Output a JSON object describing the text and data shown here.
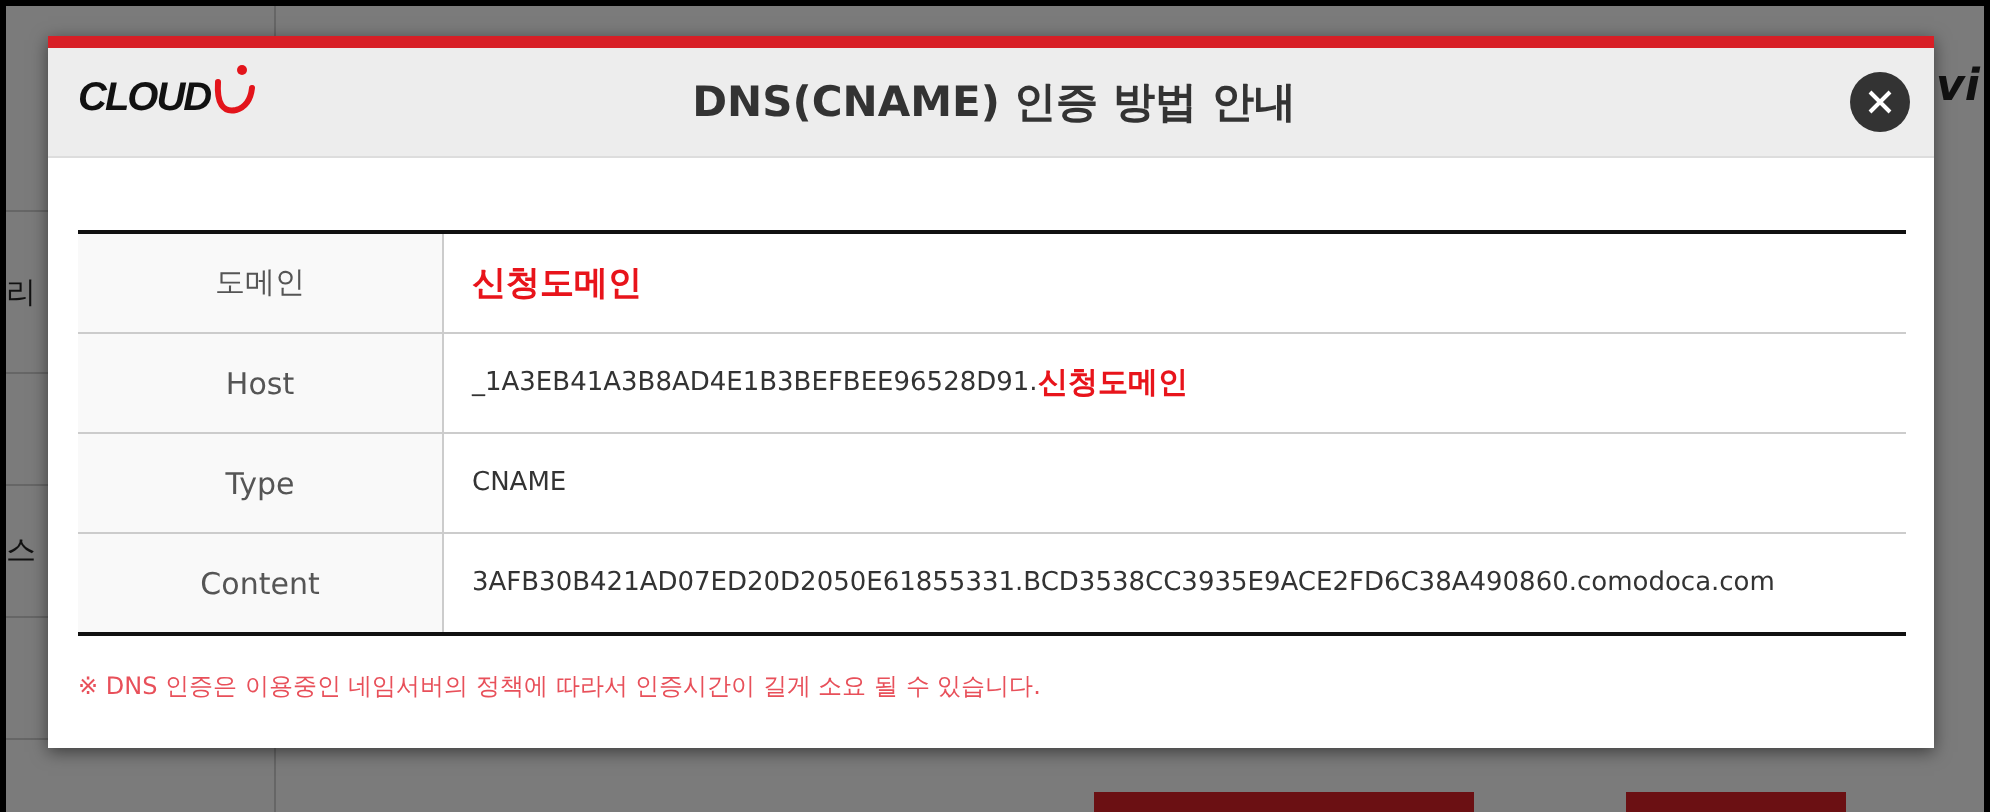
{
  "background": {
    "left_fragments": [
      "리",
      "스"
    ],
    "right_fragment": "vi"
  },
  "dialog": {
    "logo_text": "CLOUD",
    "title": "DNS(CNAME) 인증 방법 안내",
    "rows": [
      {
        "label": "도메인",
        "parts": [
          {
            "text": "신청도메인",
            "kind": "highlight"
          }
        ]
      },
      {
        "label": "Host",
        "parts": [
          {
            "text": "_1A3EB41A3B8AD4E1B3BEFBEE96528D91.",
            "kind": "plain"
          },
          {
            "text": "신청도메인",
            "kind": "highlight"
          }
        ]
      },
      {
        "label": "Type",
        "parts": [
          {
            "text": "CNAME",
            "kind": "plain"
          }
        ]
      },
      {
        "label": "Content",
        "parts": [
          {
            "text": "3AFB30B421AD07ED20D2050E61855331.BCD3538CC3935E9ACE2FD6C38A490860.comodoca.com",
            "kind": "plain"
          }
        ]
      }
    ],
    "notice": "※ DNS 인증은 이용중인 네임서버의 정책에 따라서 인증시간이 길게 소요 될 수 있습니다."
  }
}
